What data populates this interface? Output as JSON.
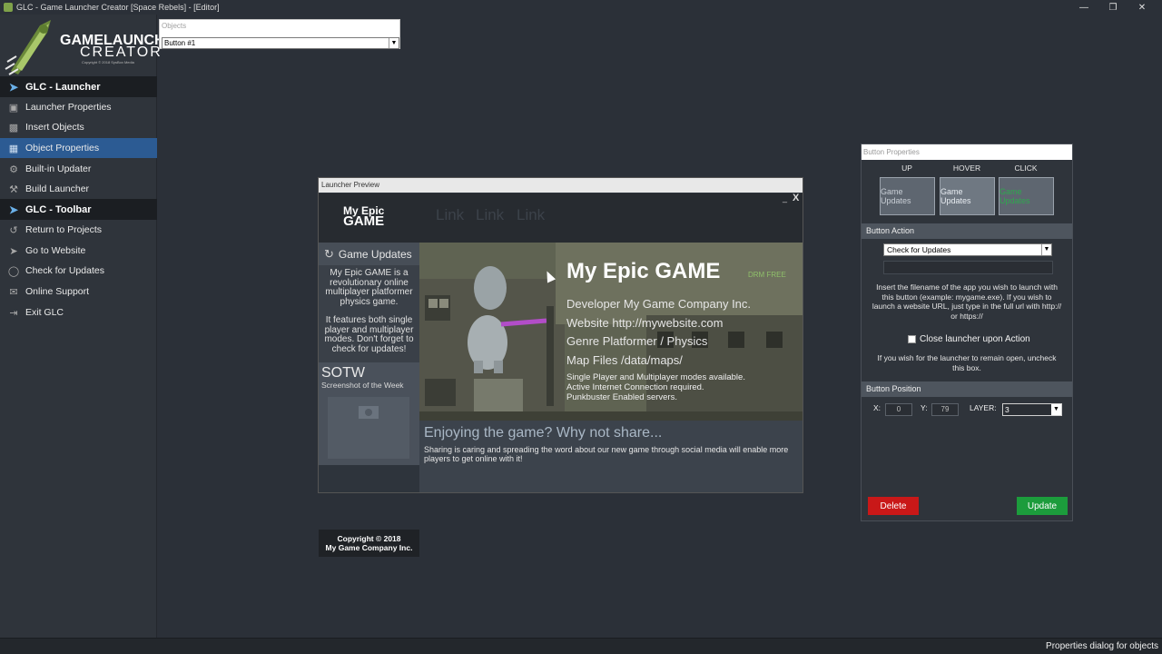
{
  "window": {
    "title": "GLC - Game Launcher Creator [Space Rebels] - [Editor]",
    "minimize": "—",
    "restore": "❐",
    "close": "✕"
  },
  "logo": {
    "line1": "GAMELAUNCHER",
    "line2": "CREATOR",
    "line3": "Copyright © 2018 SysBox Media"
  },
  "sidebar": {
    "sections": [
      {
        "label": "GLC - Launcher"
      },
      {
        "label": "GLC - Toolbar"
      }
    ],
    "launcher_items": [
      {
        "label": "Launcher Properties"
      },
      {
        "label": "Insert Objects"
      },
      {
        "label": "Object Properties"
      },
      {
        "label": "Built-in Updater"
      },
      {
        "label": "Build Launcher"
      }
    ],
    "toolbar_items": [
      {
        "label": "Return to Projects"
      },
      {
        "label": "Go to Website"
      },
      {
        "label": "Check for Updates"
      },
      {
        "label": "Online Support"
      },
      {
        "label": "Exit GLC"
      }
    ],
    "active_item": "Object Properties",
    "active_color": "#2c5b93"
  },
  "objects": {
    "label": "Objects",
    "selected": "Button #1"
  },
  "preview": {
    "title": "Launcher Preview",
    "close": "X",
    "minimize": "_",
    "brand_top": "My Epic",
    "brand_bottom": "GAME",
    "links": [
      "Link",
      "Link",
      "Link"
    ],
    "game_updates": "Game Updates",
    "desc1": "My Epic GAME is a revolutionary online multiplayer platformer physics game.",
    "desc2": "It features both single player and multiplayer modes. Don't forget to check for updates!",
    "sotw_title": "SOTW",
    "sotw_sub": "Screenshot of the Week",
    "copyright_1": "Copyright © 2018",
    "copyright_2": "My Game Company Inc.",
    "game_title": "My Epic GAME",
    "drm": "DRM FREE",
    "developer": "Developer My Game Company Inc.",
    "website": "Website http://mywebsite.com",
    "genre": "Genre Platformer / Physics",
    "mapfiles": "Map Files /data/maps/",
    "small1": "Single Player and Multiplayer modes available.",
    "small2": "Active Internet Connection required.",
    "small3": "Punkbuster Enabled servers.",
    "share_title": "Enjoying the game? Why not share...",
    "share_text": "Sharing is caring and spreading the word about our new game through social media will enable more players to get online with it!"
  },
  "button_properties": {
    "title": "Button Properties",
    "states": [
      {
        "label": "UP",
        "preview_text": "Game Updates"
      },
      {
        "label": "HOVER",
        "preview_text": "Game Updates"
      },
      {
        "label": "CLICK",
        "preview_text": "Game Updates"
      }
    ],
    "action_section": "Button Action",
    "action_value": "Check for Updates",
    "action_help": "Insert the filename of the app you wish to launch with this button (example: mygame.exe). If you wish to launch a website URL, just type in the full url with http:// or https://",
    "close_launcher_label": "Close launcher upon Action",
    "close_help": "If you wish for the launcher to remain open, uncheck this box.",
    "position_section": "Button Position",
    "x_label": "X:",
    "x_value": "0",
    "y_label": "Y:",
    "y_value": "79",
    "layer_label": "LAYER:",
    "layer_value": "3",
    "delete_label": "Delete",
    "update_label": "Update",
    "delete_color": "#c91818",
    "update_color": "#1c9c3c"
  },
  "statusbar": {
    "text": "Properties dialog for objects"
  }
}
